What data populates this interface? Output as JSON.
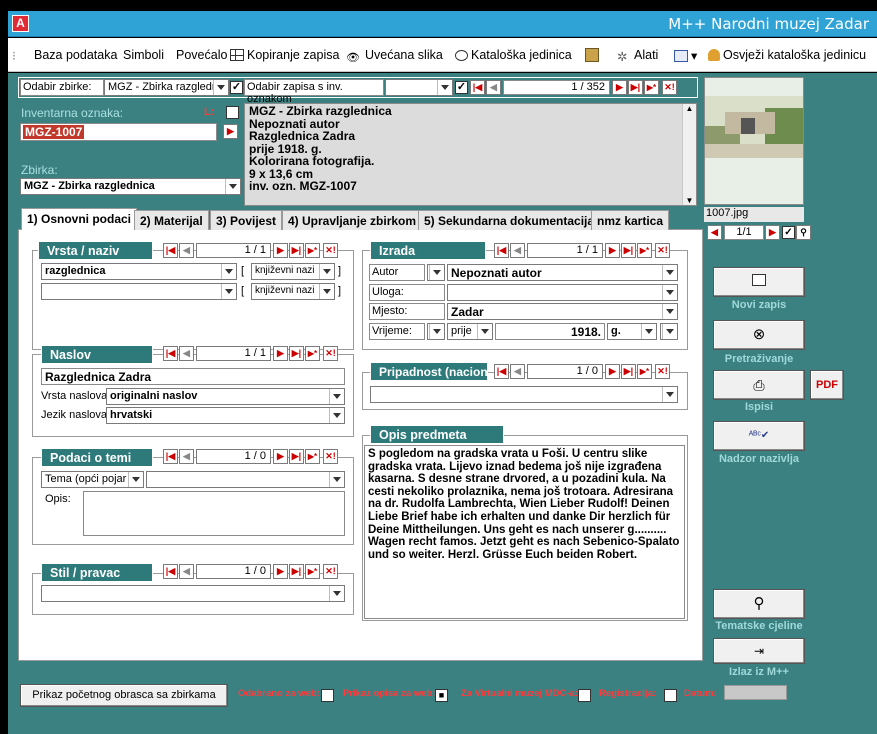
{
  "app": {
    "icon": "A",
    "title": "M++ Narodni muzej Zadar"
  },
  "toolbar": {
    "baza": "Baza podataka",
    "simboli": "Simboli",
    "povecalo": "Povećalo",
    "kopiranje": "Kopiranje zapisa",
    "uvecana": "Uvećana slika",
    "kataloska": "Kataloška jedinica",
    "alati": "Alati",
    "osvjezi": "Osvježi kataloška jedinicu"
  },
  "filter": {
    "odabir_zbirke_label": "Odabir zbirke:",
    "zbirka_value": "MGZ - Zbirka razgledr",
    "inv_label": "Odabir zapisa s inv. oznakom",
    "counter": "1 / 352"
  },
  "record": {
    "inv_label": "Inventarna oznaka:",
    "l_label": "L:",
    "inv_value": "MGZ-1007",
    "zbirka_label": "Zbirka:",
    "zbirka_value": "MGZ - Zbirka razglednica",
    "summary": [
      "MGZ - Zbirka razglednica",
      "Nepoznati autor",
      "Razglednica Zadra",
      "prije 1918. g.",
      "Kolorirana fotografija.",
      "9 x 13,6 cm",
      "inv. ozn. MGZ-1007"
    ]
  },
  "image": {
    "filename": "1007.jpg",
    "counter": "1/1"
  },
  "tabs": [
    "1) Osnovni podaci",
    "2) Materijal",
    "3) Povijest",
    "4) Upravljanje zbirkom",
    "5) Sekundarna dokumentacija",
    "nmz kartica"
  ],
  "vrsta": {
    "title": "Vrsta / naziv",
    "counter": "1 / 1",
    "row1_value": "razglednica",
    "row1_type": "književni nazi",
    "row2_type": "književni nazi"
  },
  "naslov": {
    "title": "Naslov",
    "counter": "1 / 1",
    "value": "Razglednica Zadra",
    "vrsta_label": "Vrsta naslova:",
    "vrsta_value": "originalni naslov",
    "jezik_label": "Jezik naslova:",
    "jezik_value": "hrvatski"
  },
  "tema": {
    "title": "Podaci o temi",
    "counter": "1 / 0",
    "tema_label": "Tema (opći pojar",
    "opis_label": "Opis:"
  },
  "stil": {
    "title": "Stil / pravac",
    "counter": "1 / 0"
  },
  "izrada": {
    "title": "Izrada",
    "counter": "1 / 1",
    "autor_label": "Autor",
    "autor_value": "Nepoznati autor",
    "uloga_label": "Uloga:",
    "mjesto_label": "Mjesto:",
    "mjesto_value": "Zadar",
    "vrijeme_label": "Vrijeme:",
    "prije": "prije",
    "year": "1918.",
    "g": "g."
  },
  "pripadnost": {
    "title": "Pripadnost (nacion",
    "counter": "1 / 0"
  },
  "opis": {
    "title": "Opis predmeta",
    "text": "S pogledom na gradska vrata u Foši. U centru slike gradska vrata. Lijevo iznad bedema još nije izgrađena kasarna. S desne strane drvored, a u pozadini kula. Na cesti nekoliko prolaznika, nema još trotoara. Adresirana na dr. Rudolfa Lambrechta, Wien Lieber Rudolf! Deinen Liebe Brief habe ich erhalten und danke Dir herzlich für Deine Mittheilungen. Uns geht es nach unserer g.......... Wagen recht famos. Jetzt geht es nach Sebenico-Spalato und so weiter. Herzl. Grüsse Euch beiden    Robert."
  },
  "side": {
    "novi": "Novi zapis",
    "pretrazivanje": "Pretraživanje",
    "ispisi": "Ispisi",
    "pdf": "PDF",
    "nadzor": "Nadzor nazivlja",
    "tematske": "Tematske cjeline",
    "izlaz": "Izlaz iz M++"
  },
  "bottom": {
    "prikaz_btn": "Prikaz početnog obrasca sa zbirkama",
    "web_label": "Odabrano za web:",
    "opis_web_label": "Prikaz opisa za web:",
    "virtual_label": "Za Virtualni muzej MDC-a:",
    "reg_label": "Registracija:",
    "datum_label": "Datum:"
  }
}
